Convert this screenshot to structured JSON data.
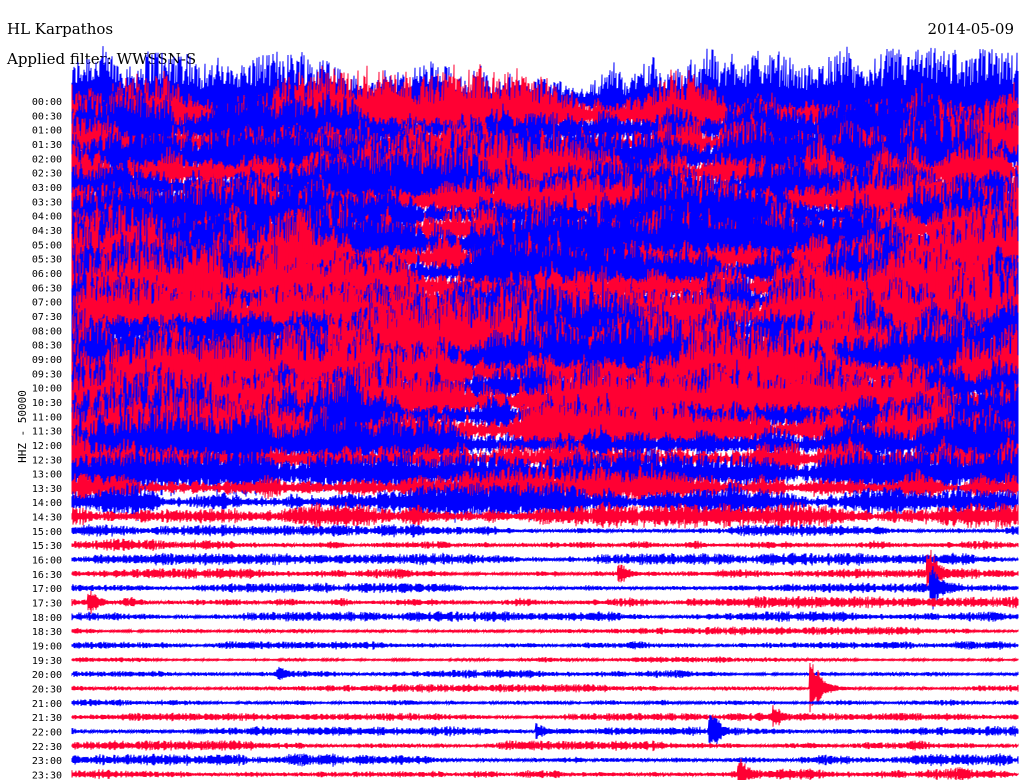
{
  "header": {
    "station": "HL Karpathos",
    "filter": "Applied filter: WWSSN-S",
    "date": "2014-05-09"
  },
  "chart_data": {
    "type": "line",
    "title": "HL Karpathos",
    "ylabel": "HHZ - 50000",
    "minutes_per_line": 30,
    "colors": [
      "#0000ff",
      "#ff0033"
    ],
    "rows": [
      "00:00",
      "00:30",
      "01:00",
      "01:30",
      "02:00",
      "02:30",
      "03:00",
      "03:30",
      "04:00",
      "04:30",
      "05:00",
      "05:30",
      "06:00",
      "06:30",
      "07:00",
      "07:30",
      "08:00",
      "08:30",
      "09:00",
      "09:30",
      "10:00",
      "10:30",
      "11:00",
      "11:30",
      "12:00",
      "12:30",
      "13:00",
      "13:30",
      "14:00",
      "14:30",
      "15:00",
      "15:30",
      "16:00",
      "16:30",
      "17:00",
      "17:30",
      "18:00",
      "18:30",
      "19:00",
      "19:30",
      "20:00",
      "20:30",
      "21:00",
      "21:30",
      "22:00",
      "22:30",
      "23:00",
      "23:30"
    ],
    "relative_amplitude": [
      2.4,
      2.4,
      2.3,
      2.3,
      2.2,
      2.2,
      1.8,
      1.6,
      2.0,
      2.2,
      2.4,
      2.4,
      2.3,
      2.3,
      2.4,
      2.4,
      2.4,
      2.3,
      2.3,
      2.3,
      2.2,
      2.1,
      2.0,
      2.0,
      1.8,
      1.6,
      1.3,
      1.1,
      0.9,
      0.7,
      0.3,
      0.3,
      0.3,
      0.25,
      0.25,
      0.3,
      0.25,
      0.2,
      0.2,
      0.15,
      0.2,
      0.2,
      0.2,
      0.2,
      0.25,
      0.25,
      0.3,
      0.35
    ],
    "events": [
      {
        "row": 33,
        "minute": 27.2,
        "amp": 2.0
      },
      {
        "row": 34,
        "minute": 27.3,
        "amp": 1.6
      },
      {
        "row": 33,
        "minute": 17.4,
        "amp": 0.8
      },
      {
        "row": 35,
        "minute": 0.6,
        "amp": 0.9
      },
      {
        "row": 40,
        "minute": 6.6,
        "amp": 0.6
      },
      {
        "row": 41,
        "minute": 23.5,
        "amp": 2.2
      },
      {
        "row": 43,
        "minute": 22.3,
        "amp": 0.9
      },
      {
        "row": 44,
        "minute": 14.8,
        "amp": 0.6
      },
      {
        "row": 44,
        "minute": 20.3,
        "amp": 1.5
      },
      {
        "row": 47,
        "minute": 21.2,
        "amp": 1.2
      }
    ]
  }
}
